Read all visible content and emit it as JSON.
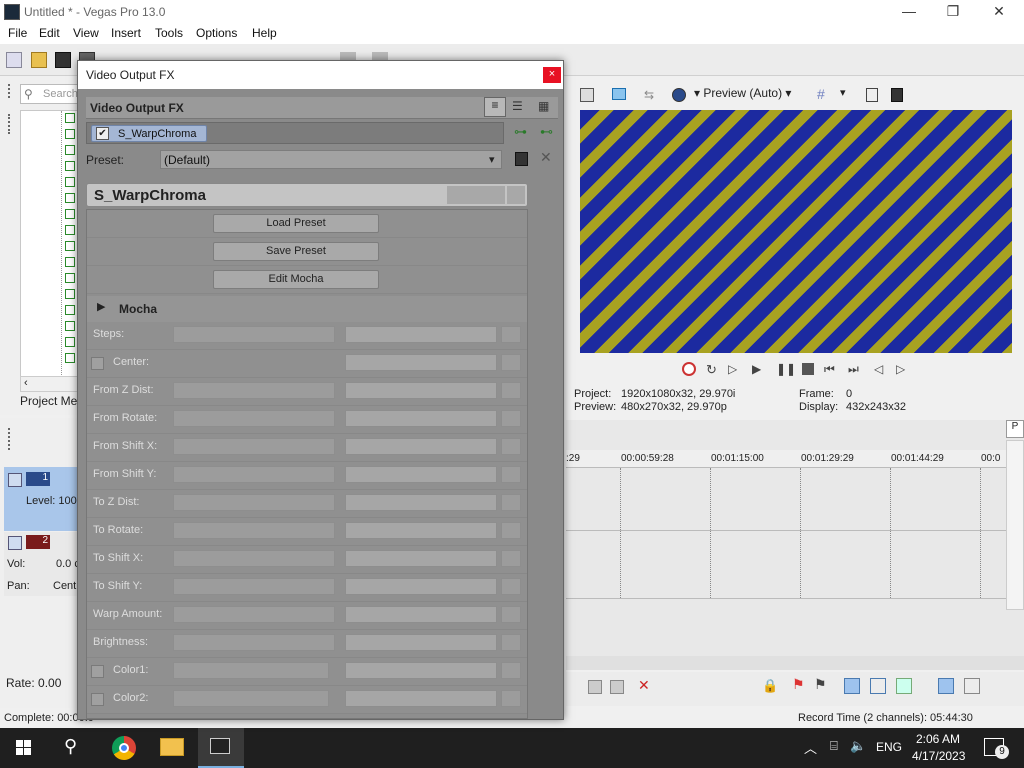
{
  "window": {
    "title": "Untitled * - Vegas Pro 13.0",
    "minimize": "—",
    "maximize": "❐",
    "close": "✕"
  },
  "menu": [
    "File",
    "Edit",
    "View",
    "Insert",
    "Tools",
    "Options",
    "Help"
  ],
  "left_panel": {
    "search_placeholder": "Search",
    "project_media_label": "Project Med"
  },
  "tracks": {
    "track1_number": "1",
    "track1_level": "Level: 100",
    "track2_number": "2",
    "track2_vol": "Vol:",
    "track2_vol_value": "0.0 c",
    "track2_pan": "Pan:",
    "track2_pan_value": "Cent",
    "rate": "Rate: 0.00"
  },
  "preview": {
    "mode": "Preview (Auto)",
    "project_label": "Project:",
    "project_value": "1920x1080x32, 29.970i",
    "preview_label": "Preview:",
    "preview_value": "480x270x32, 29.970p",
    "frame_label": "Frame:",
    "frame_value": "0",
    "display_label": "Display:",
    "display_value": "432x243x32"
  },
  "timeline": {
    "ticks": [
      ":29",
      "00:00:59:28",
      "00:01:15:00",
      "00:01:29:29",
      "00:01:44:29",
      "00:0"
    ]
  },
  "status": {
    "complete": "Complete: 00:00:0",
    "record_time": "Record Time (2 channels): 05:44:30"
  },
  "taskbar": {
    "lang": "ENG",
    "time": "2:06 AM",
    "date": "4/17/2023",
    "notif_count": "9"
  },
  "dialog": {
    "title": "Video Output FX",
    "close": "×",
    "section_label": "Video Output FX",
    "chain_item": "S_WarpChroma",
    "preset_label": "Preset:",
    "preset_value": "(Default)",
    "plugin_title": "S_WarpChroma",
    "load_preset": "Load Preset",
    "save_preset": "Save Preset",
    "edit_mocha": "Edit Mocha",
    "mocha": "Mocha",
    "params": [
      "Steps:",
      "Center:",
      "From Z Dist:",
      "From Rotate:",
      "From Shift X:",
      "From Shift Y:",
      "To Z Dist:",
      "To Rotate:",
      "To Shift X:",
      "To Shift Y:",
      "Warp Amount:",
      "Brightness:",
      "Color1:",
      "Color2:"
    ]
  },
  "colors": {
    "stripe_blue": "#1c2aa0",
    "stripe_yellow": "#a8a221",
    "close_red": "#e81123",
    "track_blue": "#a9c6ea"
  }
}
